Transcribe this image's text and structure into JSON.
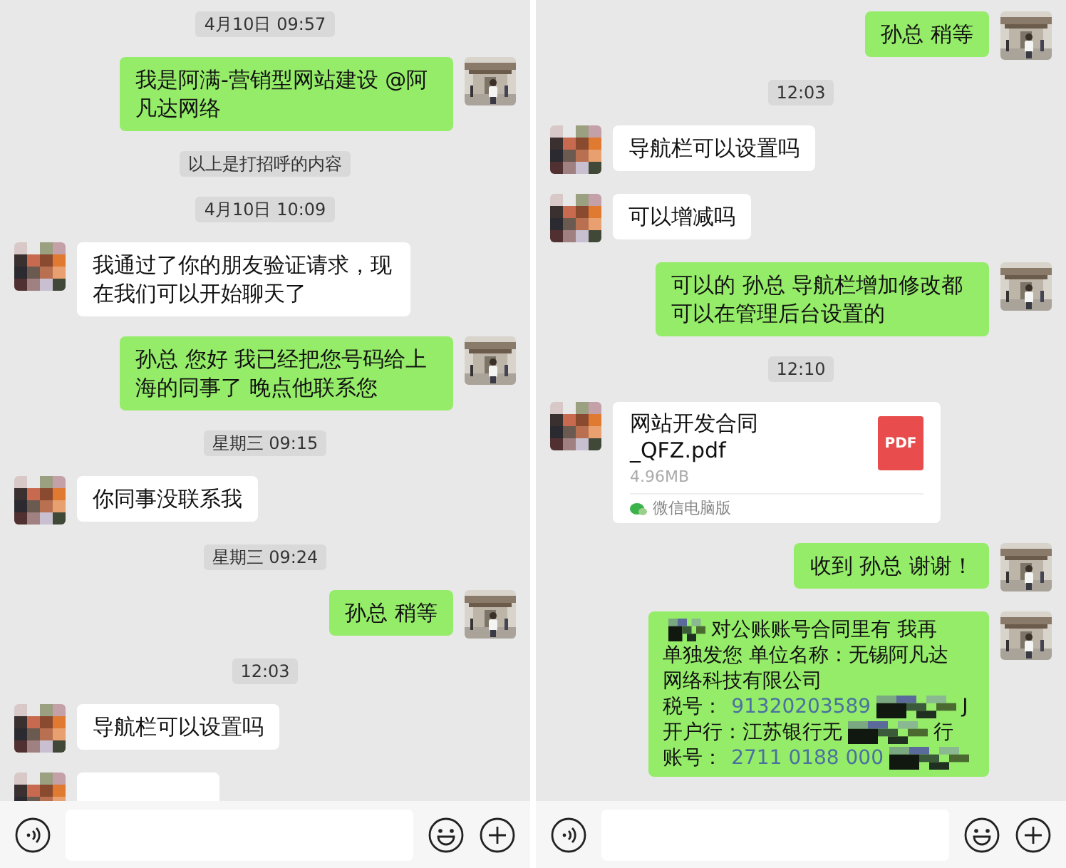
{
  "panels": [
    {
      "items": [
        {
          "kind": "time",
          "text": "4月10日 09:57"
        },
        {
          "kind": "out",
          "text": "我是阿满-营销型网站建设 @阿凡达网络"
        },
        {
          "kind": "system",
          "text": "以上是打招呼的内容"
        },
        {
          "kind": "time",
          "text": "4月10日 10:09"
        },
        {
          "kind": "in",
          "text": "我通过了你的朋友验证请求，现在我们可以开始聊天了"
        },
        {
          "kind": "out",
          "text": "孙总 您好 我已经把您号码给上海的同事了 晚点他联系您"
        },
        {
          "kind": "time",
          "text": "星期三 09:15"
        },
        {
          "kind": "in",
          "text": "你同事没联系我"
        },
        {
          "kind": "time",
          "text": "星期三 09:24"
        },
        {
          "kind": "out",
          "text": "孙总 稍等"
        },
        {
          "kind": "time",
          "text": "12:03"
        },
        {
          "kind": "in",
          "text": "导航栏可以设置吗"
        },
        {
          "kind": "in_clipped"
        }
      ]
    },
    {
      "items": [
        {
          "kind": "out",
          "text": "孙总 稍等"
        },
        {
          "kind": "time",
          "text": "12:03"
        },
        {
          "kind": "in",
          "text": "导航栏可以设置吗"
        },
        {
          "kind": "in",
          "text": "可以增减吗"
        },
        {
          "kind": "out",
          "text": "可以的 孙总  导航栏增加修改都可以在管理后台设置的"
        },
        {
          "kind": "time",
          "text": "12:10"
        },
        {
          "kind": "file",
          "name": "网站开发合同_QFZ.pdf",
          "size": "4.96MB",
          "source": "微信电脑版",
          "badge": "PDF"
        },
        {
          "kind": "out",
          "text": "收到 孙总 谢谢！"
        },
        {
          "kind": "details",
          "lines": [
            {
              "text": "对公账账号合同里有 我再",
              "redacted_lead": true
            },
            {
              "text": "单独发您 单位名称：无锡阿凡达"
            },
            {
              "text": "网络科技有限公司"
            },
            {
              "text": "税号：",
              "value": "91320203589",
              "linked": true,
              "redacted": true,
              "tail": "J"
            },
            {
              "text": "开户行：",
              "value": "江苏银行无",
              "linked": false,
              "redacted": true,
              "tail": "行"
            },
            {
              "text": "账号：",
              "value": "2711 0188 000",
              "linked": true,
              "redacted": true
            }
          ]
        }
      ]
    }
  ]
}
